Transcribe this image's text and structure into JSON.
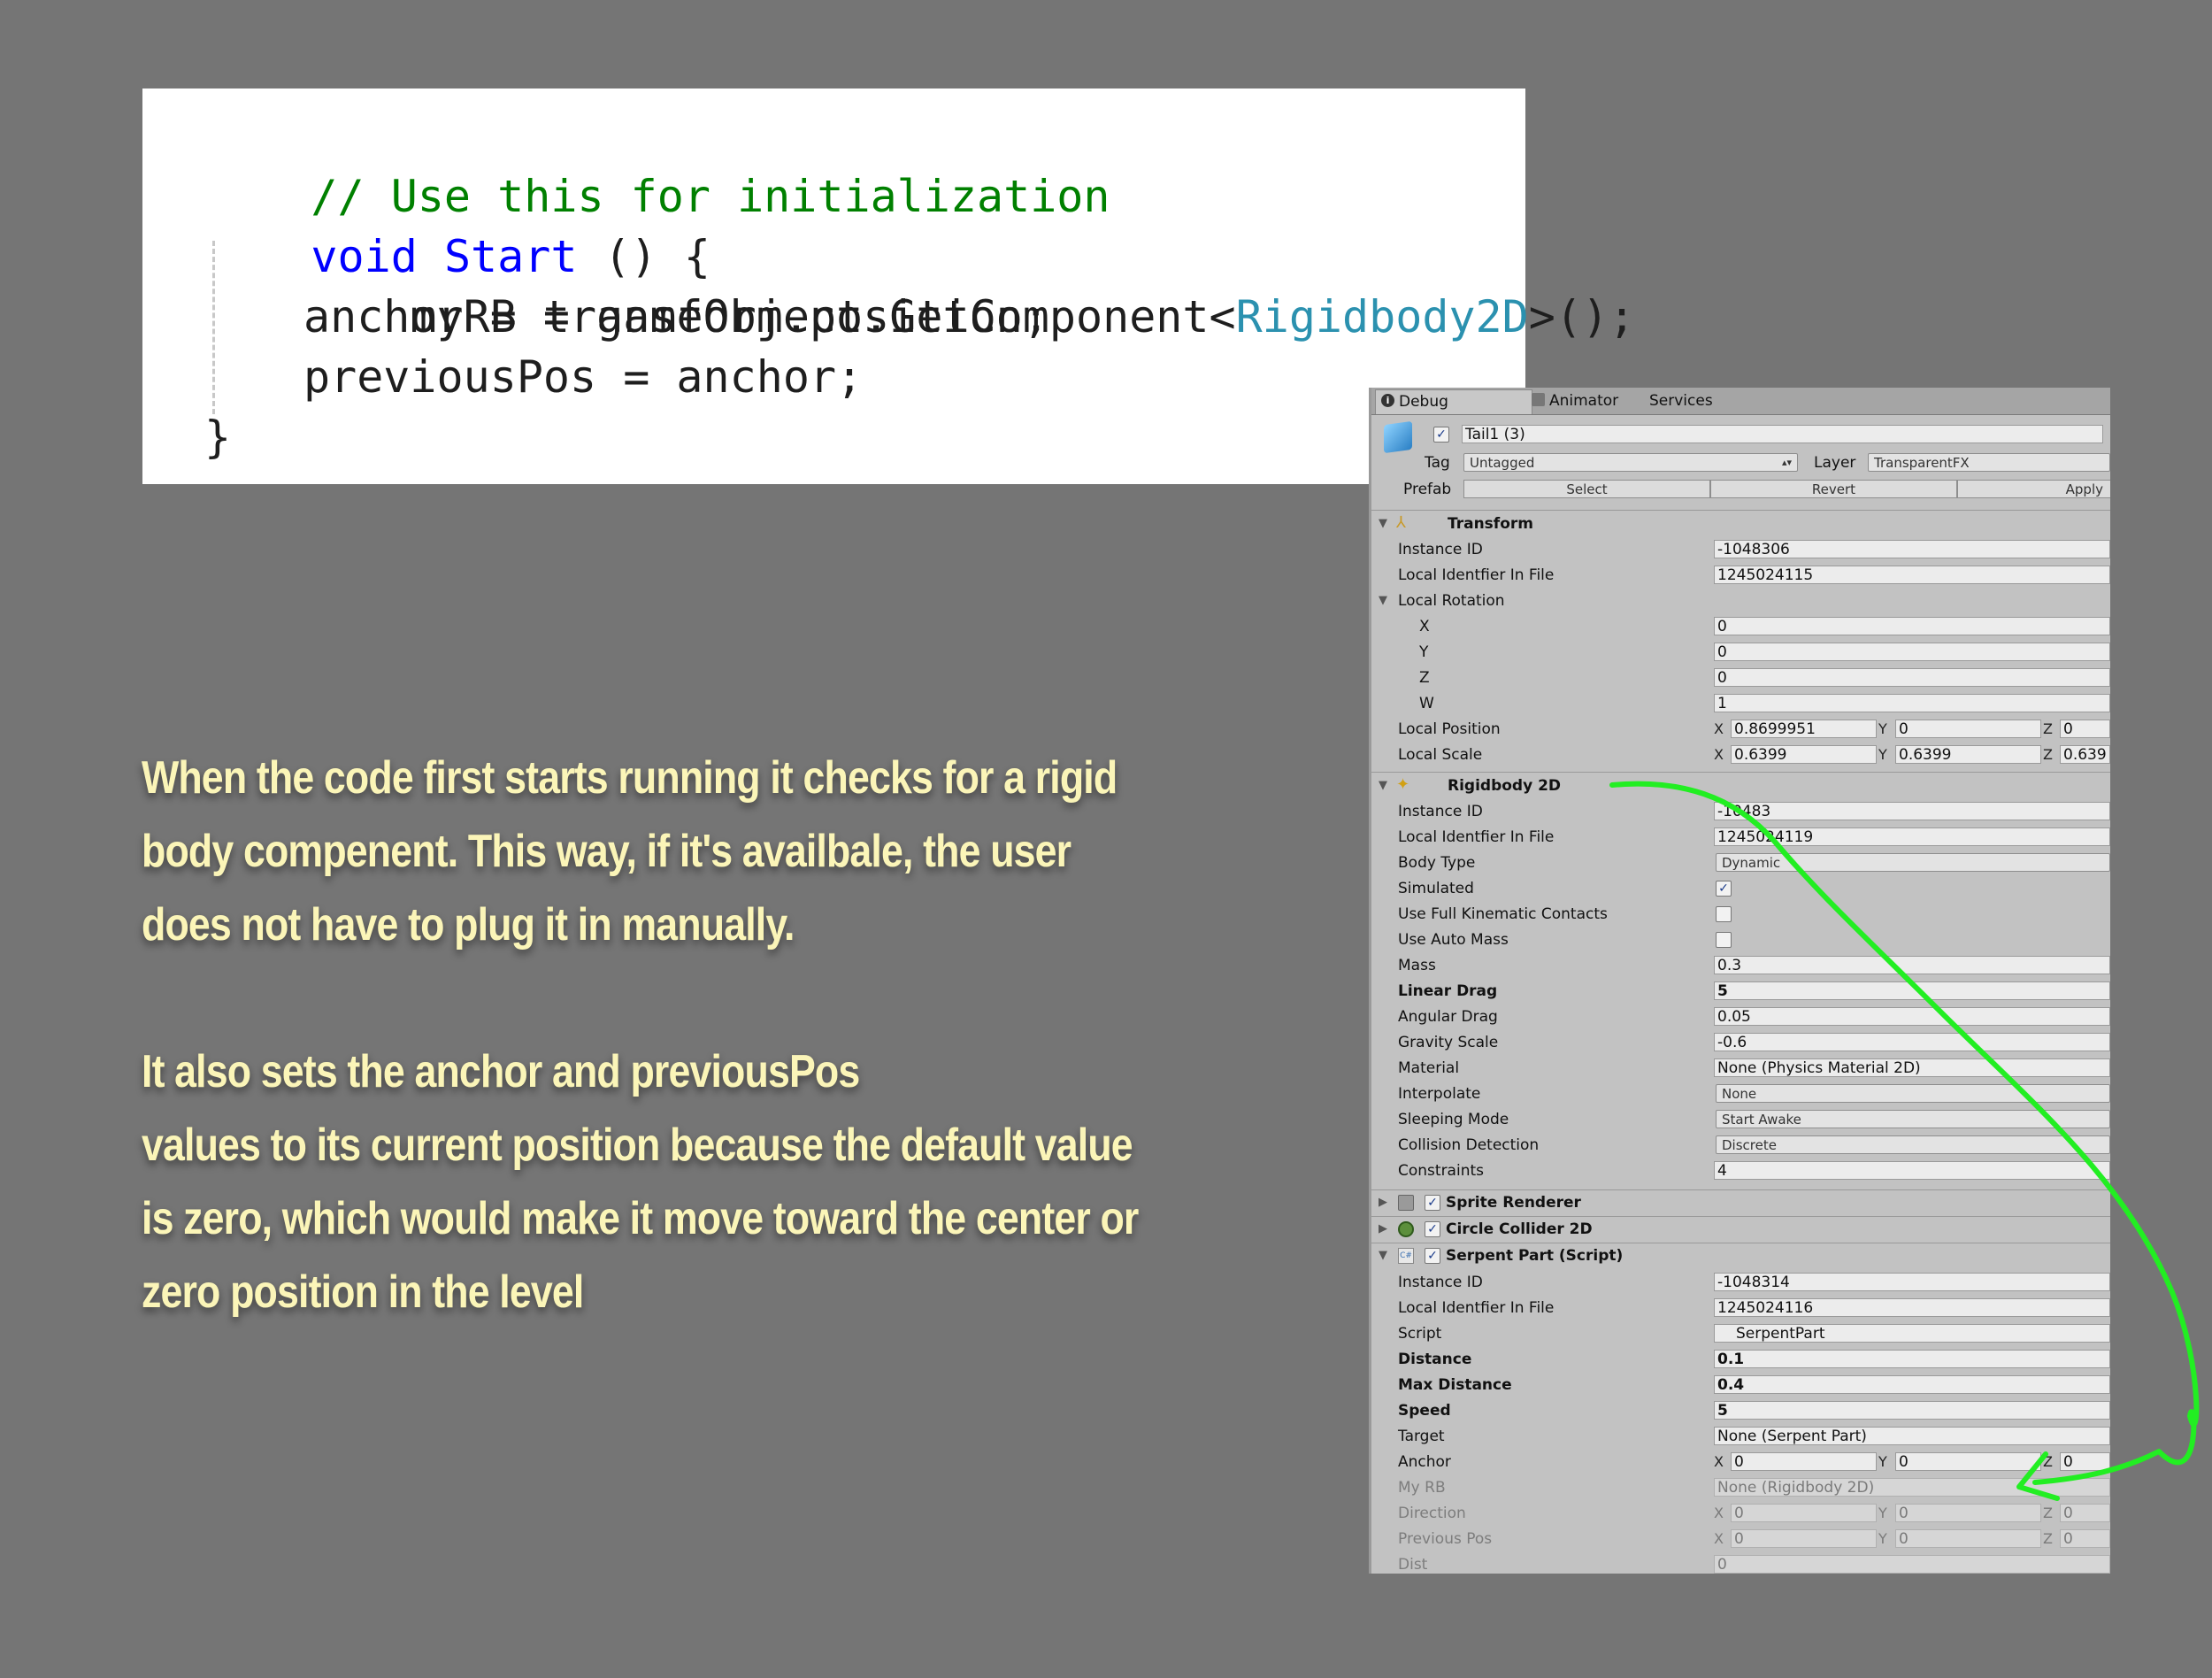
{
  "code": {
    "comment": "// Use this for initialization",
    "kw_void": "void",
    "start": "Start",
    "start_rest": " () {",
    "l3_a": "myRB = gameObject.GetComponent<",
    "l3_type": "Rigidbody2D",
    "l3_b": ">();",
    "l4": "anchor = transform.position;",
    "l5": "previousPos = anchor;",
    "close": "}"
  },
  "description": {
    "p1": "When the code first starts running it checks for a rigid body compenent. This way, if it's availbale, the user does not have to plug it in manually.",
    "p2_line1": "It also sets the anchor and previousPos",
    "p2_line2": "values to its current position because the default value is zero, which would make it move toward the center or zero position in the level"
  },
  "inspector": {
    "tabs": {
      "debug": "Debug",
      "animator": "Animator",
      "services": "Services"
    },
    "object_name": "Tail1 (3)",
    "tag_label": "Tag",
    "tag_value": "Untagged",
    "layer_label": "Layer",
    "layer_value": "TransparentFX",
    "prefab_label": "Prefab",
    "prefab_select": "Select",
    "prefab_revert": "Revert",
    "prefab_apply": "Apply",
    "transform": {
      "title": "Transform",
      "instance_id_label": "Instance ID",
      "instance_id": "-1048306",
      "local_id_label": "Local Identfier In File",
      "local_id": "1245024115",
      "local_rotation_label": "Local Rotation",
      "x_label": "X",
      "x": "0",
      "y_label": "Y",
      "y": "0",
      "z_label": "Z",
      "z": "0",
      "w_label": "W",
      "w": "1",
      "local_position_label": "Local Position",
      "pos_x": "0.8699951",
      "pos_y": "0",
      "pos_z": "0",
      "local_scale_label": "Local Scale",
      "scale_x": "0.6399",
      "scale_y": "0.6399",
      "scale_z": "0.639"
    },
    "rigidbody": {
      "title": "Rigidbody 2D",
      "instance_id_label": "Instance ID",
      "instance_id": "-10483",
      "local_id_label": "Local Identfier In File",
      "local_id": "1245024119",
      "body_type_label": "Body Type",
      "body_type": "Dynamic",
      "simulated_label": "Simulated",
      "full_kinematic_label": "Use Full Kinematic Contacts",
      "auto_mass_label": "Use Auto Mass",
      "mass_label": "Mass",
      "mass": "0.3",
      "linear_drag_label": "Linear Drag",
      "linear_drag": "5",
      "angular_drag_label": "Angular Drag",
      "angular_drag": "0.05",
      "gravity_label": "Gravity Scale",
      "gravity": "-0.6",
      "material_label": "Material",
      "material": "None (Physics Material 2D)",
      "interpolate_label": "Interpolate",
      "interpolate": "None",
      "sleeping_label": "Sleeping Mode",
      "sleeping": "Start Awake",
      "collision_label": "Collision Detection",
      "collision": "Discrete",
      "constraints_label": "Constraints",
      "constraints": "4"
    },
    "sprite_renderer": "Sprite Renderer",
    "circle_collider": "Circle Collider 2D",
    "serpent": {
      "title": "Serpent Part (Script)",
      "instance_id_label": "Instance ID",
      "instance_id": "-1048314",
      "local_id_label": "Local Identfier In File",
      "local_id": "1245024116",
      "script_label": "Script",
      "script": "SerpentPart",
      "distance_label": "Distance",
      "distance": "0.1",
      "max_distance_label": "Max Distance",
      "max_distance": "0.4",
      "speed_label": "Speed",
      "speed": "5",
      "target_label": "Target",
      "target": "None (Serpent Part)",
      "anchor_label": "Anchor",
      "anchor_x": "0",
      "anchor_y": "0",
      "anchor_z": "0",
      "my_rb_label": "My RB",
      "my_rb": "None (Rigidbody 2D)",
      "direction_label": "Direction",
      "dir_x": "0",
      "dir_y": "0",
      "dir_z": "0",
      "previous_pos_label": "Previous Pos",
      "prev_x": "0",
      "prev_y": "0",
      "prev_z": "0",
      "dist_label": "Dist",
      "dist": "0"
    }
  },
  "colors": {
    "background": "#757575",
    "annotation": "#22ee22",
    "description_text": "#fbf5b8",
    "comment": "#008000",
    "keyword": "#0000ff",
    "type": "#2b91af"
  }
}
